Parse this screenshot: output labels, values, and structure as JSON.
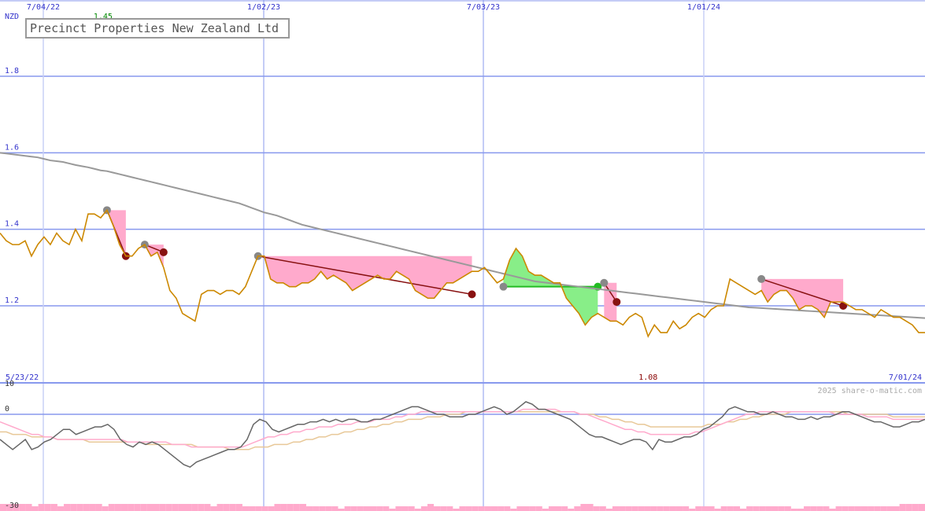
{
  "title": "Precinct Properties New Zealand Ltd",
  "currency": "NZD",
  "watermark": "2025 share-o-matic.com",
  "colors": {
    "price": "#cc8800",
    "moving_average": "#999999",
    "grid_major": "#8899ee",
    "grid_minor": "#c8d0f6",
    "loss_fill": "#ffaacc",
    "gain_fill": "#88ee88",
    "loss_line": "#881111",
    "gain_line": "#22bb22",
    "high_label": "#008800",
    "low_label": "#880000",
    "axis_text": "#3333cc",
    "osc_main": "#666666",
    "osc_pink": "#ffaacc",
    "osc_tan": "#e8c898",
    "volume": "#ffaacc"
  },
  "chart_data": [
    {
      "type": "line",
      "x_ticks": [
        "7/04/22",
        "1/02/23",
        "7/03/23",
        "1/01/24"
      ],
      "x_ticks_date": [
        "2022-04-07",
        "2023-02-01",
        "2023-03-07",
        "2024-01-01"
      ],
      "x_range": [
        "2022-05-23",
        "2024-01-07"
      ],
      "x_range_labels": {
        "start": "5/23/22",
        "end": "7/01/24"
      },
      "y_ticks": [
        1.8,
        1.6,
        1.4,
        1.2
      ],
      "y_tick_labels": [
        "1.8",
        "1.6",
        "1.4",
        "1.2"
      ],
      "ylim": [
        1.0,
        2.0
      ],
      "annotations": {
        "high": "1.45",
        "low": "1.08"
      },
      "series": [
        {
          "values": [
            1.39,
            1.37,
            1.36,
            1.36,
            1.37,
            1.33,
            1.36,
            1.38,
            1.36,
            1.39,
            1.37,
            1.36,
            1.4,
            1.37,
            1.44,
            1.44,
            1.43,
            1.45,
            1.41,
            1.36,
            1.33,
            1.33,
            1.35,
            1.36,
            1.33,
            1.34,
            1.3,
            1.24,
            1.22,
            1.18,
            1.17,
            1.16,
            1.23,
            1.24,
            1.24,
            1.23,
            1.24,
            1.24,
            1.23,
            1.25,
            1.29,
            1.33,
            1.33,
            1.27,
            1.26,
            1.26,
            1.25,
            1.25,
            1.26,
            1.26,
            1.27,
            1.29,
            1.27,
            1.28,
            1.27,
            1.26,
            1.24,
            1.25,
            1.26,
            1.27,
            1.28,
            1.27,
            1.27,
            1.29,
            1.28,
            1.27,
            1.24,
            1.23,
            1.22,
            1.22,
            1.24,
            1.26,
            1.26,
            1.27,
            1.28,
            1.29,
            1.29,
            1.3,
            1.28,
            1.26,
            1.27,
            1.32,
            1.35,
            1.33,
            1.29,
            1.28,
            1.28,
            1.27,
            1.26,
            1.26,
            1.22,
            1.2,
            1.18,
            1.15,
            1.17,
            1.18,
            1.17,
            1.16,
            1.16,
            1.15,
            1.17,
            1.18,
            1.17,
            1.12,
            1.15,
            1.13,
            1.13,
            1.16,
            1.14,
            1.15,
            1.17,
            1.18,
            1.17,
            1.19,
            1.2,
            1.2,
            1.27,
            1.26,
            1.25,
            1.24,
            1.23,
            1.24,
            1.21,
            1.23,
            1.24,
            1.24,
            1.22,
            1.19,
            1.2,
            1.2,
            1.19,
            1.17,
            1.21,
            1.21,
            1.21,
            1.2,
            1.19,
            1.19,
            1.18,
            1.17,
            1.19,
            1.18,
            1.17,
            1.17,
            1.16,
            1.15,
            1.13,
            1.13
          ]
        },
        {
          "values": [
            1.6,
            1.598,
            1.596,
            1.594,
            1.592,
            1.59,
            1.588,
            1.584,
            1.58,
            1.578,
            1.576,
            1.572,
            1.568,
            1.565,
            1.562,
            1.558,
            1.554,
            1.552,
            1.548,
            1.544,
            1.54,
            1.536,
            1.532,
            1.528,
            1.524,
            1.52,
            1.516,
            1.512,
            1.508,
            1.504,
            1.5,
            1.496,
            1.492,
            1.488,
            1.484,
            1.48,
            1.476,
            1.472,
            1.468,
            1.462,
            1.456,
            1.45,
            1.444,
            1.44,
            1.436,
            1.43,
            1.424,
            1.418,
            1.412,
            1.408,
            1.404,
            1.4,
            1.396,
            1.392,
            1.388,
            1.384,
            1.38,
            1.376,
            1.372,
            1.368,
            1.364,
            1.36,
            1.356,
            1.352,
            1.348,
            1.344,
            1.34,
            1.336,
            1.332,
            1.328,
            1.324,
            1.32,
            1.316,
            1.312,
            1.308,
            1.304,
            1.3,
            1.296,
            1.292,
            1.288,
            1.284,
            1.28,
            1.276,
            1.272,
            1.268,
            1.264,
            1.262,
            1.26,
            1.258,
            1.256,
            1.254,
            1.252,
            1.25,
            1.248,
            1.246,
            1.244,
            1.242,
            1.24,
            1.238,
            1.236,
            1.234,
            1.232,
            1.23,
            1.228,
            1.226,
            1.224,
            1.222,
            1.22,
            1.218,
            1.216,
            1.214,
            1.212,
            1.21,
            1.208,
            1.206,
            1.204,
            1.202,
            1.2,
            1.198,
            1.196,
            1.195,
            1.194,
            1.193,
            1.192,
            1.191,
            1.19,
            1.189,
            1.188,
            1.187,
            1.186,
            1.185,
            1.184,
            1.183,
            1.182,
            1.181,
            1.18,
            1.179,
            1.178,
            1.177,
            1.176,
            1.175,
            1.174,
            1.173,
            1.172,
            1.171,
            1.17,
            1.169,
            1.168
          ]
        }
      ],
      "patterns": [
        {
          "kind": "loss",
          "from_index": 17,
          "to_index": 20,
          "from_value": 1.45,
          "to_value": 1.33
        },
        {
          "kind": "loss",
          "from_index": 23,
          "to_index": 26,
          "from_value": 1.36,
          "to_value": 1.34
        },
        {
          "kind": "loss",
          "from_index": 41,
          "to_index": 75,
          "from_value": 1.33,
          "to_value": 1.23
        },
        {
          "kind": "gain",
          "from_index": 80,
          "to_index": 95,
          "from_value": 1.25,
          "to_value": 1.25
        },
        {
          "kind": "loss",
          "from_index": 96,
          "to_index": 98,
          "from_value": 1.26,
          "to_value": 1.21
        },
        {
          "kind": "loss",
          "from_index": 121,
          "to_index": 134,
          "from_value": 1.27,
          "to_value": 1.2
        }
      ]
    },
    {
      "type": "line",
      "y_ticks": [
        10,
        0,
        -30
      ],
      "y_tick_labels": [
        "10",
        "0",
        "-30"
      ],
      "ylim": [
        -35,
        12
      ],
      "series": [
        {
          "values": [
            -10,
            -12,
            -14,
            -12,
            -10,
            -14,
            -13,
            -11,
            -10,
            -8,
            -6,
            -6,
            -8,
            -7,
            -6,
            -5,
            -5,
            -4,
            -6,
            -10,
            -12,
            -13,
            -11,
            -12,
            -11,
            -12,
            -14,
            -16,
            -18,
            -20,
            -21,
            -19,
            -18,
            -17,
            -16,
            -15,
            -14,
            -14,
            -13,
            -10,
            -4,
            -2,
            -3,
            -6,
            -7,
            -6,
            -5,
            -4,
            -4,
            -3,
            -3,
            -2,
            -3,
            -2,
            -3,
            -2,
            -2,
            -3,
            -3,
            -2,
            -2,
            -1,
            0,
            1,
            2,
            3,
            3,
            2,
            1,
            0,
            0,
            -1,
            -1,
            -1,
            0,
            0,
            1,
            2,
            3,
            2,
            0,
            1,
            3,
            5,
            4,
            2,
            2,
            1,
            0,
            -1,
            -2,
            -4,
            -6,
            -8,
            -9,
            -9,
            -10,
            -11,
            -12,
            -11,
            -10,
            -10,
            -11,
            -14,
            -10,
            -11,
            -11,
            -10,
            -9,
            -9,
            -8,
            -6,
            -5,
            -3,
            -1,
            2,
            3,
            2,
            1,
            1,
            0,
            0,
            1,
            0,
            -1,
            -1,
            -2,
            -2,
            -1,
            -2,
            -1,
            -1,
            0,
            1,
            1,
            0,
            -1,
            -2,
            -3,
            -3,
            -4,
            -5,
            -5,
            -4,
            -3,
            -3,
            -2
          ]
        },
        {
          "values": [
            -3,
            -4,
            -5,
            -6,
            -7,
            -8,
            -8,
            -9,
            -9,
            -10,
            -10,
            -10,
            -10,
            -10,
            -10,
            -10,
            -10,
            -10,
            -10,
            -10,
            -11,
            -11,
            -11,
            -11,
            -11,
            -11,
            -11,
            -12,
            -12,
            -12,
            -13,
            -13,
            -13,
            -13,
            -13,
            -13,
            -13,
            -13,
            -13,
            -12,
            -11,
            -10,
            -9,
            -9,
            -8,
            -8,
            -7,
            -7,
            -6,
            -6,
            -5,
            -5,
            -5,
            -4,
            -4,
            -4,
            -3,
            -3,
            -3,
            -2,
            -2,
            -2,
            -1,
            -1,
            0,
            0,
            1,
            1,
            1,
            1,
            1,
            1,
            1,
            1,
            1,
            1,
            1,
            1,
            1,
            1,
            1,
            1,
            2,
            2,
            2,
            2,
            2,
            2,
            1,
            1,
            1,
            0,
            0,
            -1,
            -2,
            -3,
            -4,
            -5,
            -6,
            -6,
            -7,
            -7,
            -8,
            -8,
            -8,
            -8,
            -8,
            -8,
            -8,
            -7,
            -7,
            -6,
            -5,
            -4,
            -3,
            -2,
            -1,
            0,
            0,
            1,
            1,
            1,
            1,
            1,
            1,
            1,
            1,
            1,
            1,
            1,
            1,
            0,
            0,
            0,
            0,
            0,
            -1,
            -1,
            -1,
            -1,
            -2,
            -2,
            -2,
            -2,
            -2,
            -2
          ]
        },
        {
          "values": [
            -7,
            -7,
            -8,
            -8,
            -8,
            -9,
            -9,
            -9,
            -9,
            -10,
            -10,
            -10,
            -10,
            -10,
            -11,
            -11,
            -11,
            -11,
            -11,
            -11,
            -11,
            -11,
            -11,
            -12,
            -12,
            -12,
            -12,
            -12,
            -12,
            -12,
            -12,
            -13,
            -13,
            -13,
            -13,
            -13,
            -14,
            -14,
            -14,
            -14,
            -13,
            -13,
            -13,
            -12,
            -12,
            -12,
            -11,
            -11,
            -10,
            -10,
            -9,
            -9,
            -8,
            -8,
            -7,
            -7,
            -6,
            -6,
            -5,
            -5,
            -4,
            -4,
            -3,
            -3,
            -2,
            -2,
            -2,
            -1,
            -1,
            -1,
            0,
            0,
            0,
            1,
            1,
            1,
            1,
            1,
            1,
            1,
            1,
            1,
            1,
            1,
            1,
            1,
            1,
            1,
            1,
            1,
            1,
            0,
            0,
            0,
            -1,
            -1,
            -2,
            -2,
            -3,
            -3,
            -4,
            -4,
            -5,
            -5,
            -5,
            -5,
            -5,
            -5,
            -5,
            -5,
            -5,
            -4,
            -4,
            -4,
            -3,
            -3,
            -2,
            -2,
            -1,
            -1,
            0,
            0,
            0,
            0,
            1,
            1,
            1,
            1,
            1,
            1,
            1,
            1,
            1,
            0,
            0,
            0,
            0,
            0,
            0,
            0,
            -1,
            -1,
            -1,
            -1,
            -1,
            -1
          ]
        }
      ],
      "volume": [
        3,
        3,
        3,
        3,
        3,
        2,
        3,
        3,
        3,
        2,
        3,
        3,
        3,
        3,
        3,
        3,
        2,
        3,
        3,
        3,
        3,
        3,
        3,
        3,
        3,
        3,
        3,
        3,
        3,
        3,
        3,
        3,
        3,
        2,
        3,
        3,
        3,
        3,
        2,
        2,
        2,
        2,
        2,
        3,
        3,
        3,
        3,
        3,
        2,
        2,
        2,
        2,
        2,
        1,
        2,
        2,
        2,
        2,
        2,
        2,
        2,
        1,
        2,
        2,
        2,
        1,
        2,
        3,
        2,
        2,
        2,
        1,
        2,
        2,
        2,
        2,
        2,
        2,
        2,
        2,
        1,
        2,
        2,
        2,
        2,
        1,
        2,
        2,
        2,
        1,
        2,
        3,
        3,
        2,
        2,
        1,
        2,
        2,
        2,
        2,
        2,
        2,
        2,
        2,
        2,
        2,
        2,
        2,
        1,
        2,
        2,
        2,
        1,
        2,
        2,
        2,
        1,
        2,
        2,
        2,
        2,
        2,
        2,
        2,
        1,
        1,
        2,
        2,
        2,
        2,
        1,
        2,
        2,
        2,
        2,
        2,
        2,
        2,
        2,
        2,
        2,
        3,
        3,
        3,
        3
      ]
    }
  ]
}
